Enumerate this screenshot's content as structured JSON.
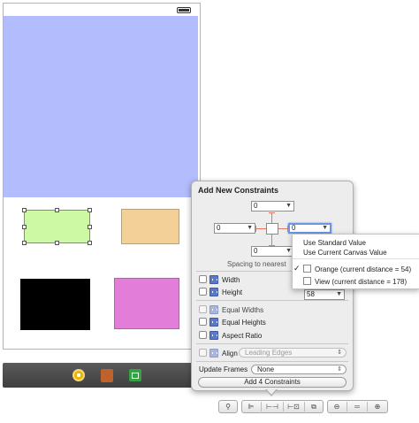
{
  "popover": {
    "title": "Add New Constraints",
    "spacing": {
      "top": "0",
      "left": "0",
      "right": "0",
      "bottom": "0",
      "label": "Spacing to nearest"
    },
    "width_label": "Width",
    "height_label": "Height",
    "height_value": "58",
    "equal_widths_label": "Equal Widths",
    "equal_heights_label": "Equal Heights",
    "aspect_ratio_label": "Aspect Ratio",
    "align_label": "Align",
    "align_value": "Leading Edges",
    "update_frames_label": "Update Frames",
    "update_frames_value": "None",
    "add_button_label": "Add 4 Constraints"
  },
  "context_menu": {
    "items": [
      "Use Standard Value",
      "Use Current Canvas Value",
      "Orange (current distance = 54)",
      "View (current distance = 178)"
    ],
    "checked_index": 2
  },
  "colors": {
    "blue_view": "#b3bcfd",
    "green_view": "#cdf9a5",
    "orange_view": "#f3d098",
    "black_view": "#000000",
    "pink_view": "#e27ed9",
    "beam": "#e57460",
    "focus": "#6d95e3"
  },
  "icons": {
    "dock": [
      "first-responder-icon",
      "object-cube-icon",
      "exit-icon"
    ],
    "toolbar": [
      "simulated-metrics-icon",
      "align-icon",
      "pin-icon",
      "resolve-icon",
      "zoom-out-icon",
      "zoom-reset-icon",
      "zoom-in-icon"
    ]
  }
}
